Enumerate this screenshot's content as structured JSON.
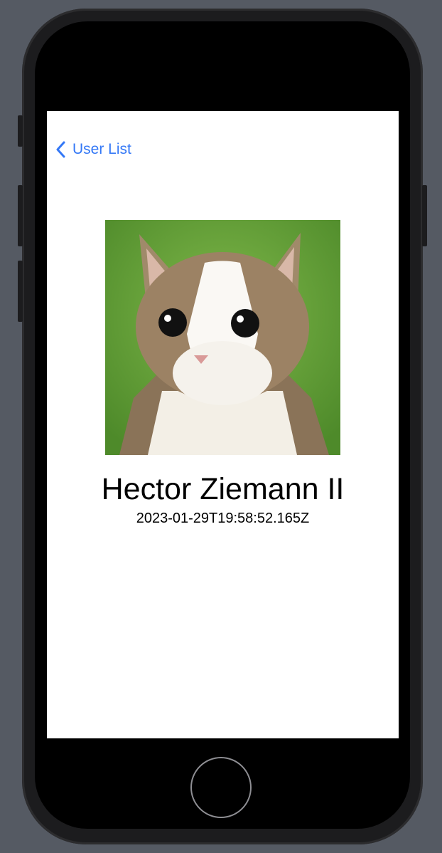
{
  "nav": {
    "back_label": "User List",
    "back_icon": "chevron-left-icon",
    "accent": "#3478f6"
  },
  "user": {
    "name": "Hector Ziemann II",
    "timestamp": "2023-01-29T19:58:52.165Z",
    "avatar": "cat-photo"
  }
}
